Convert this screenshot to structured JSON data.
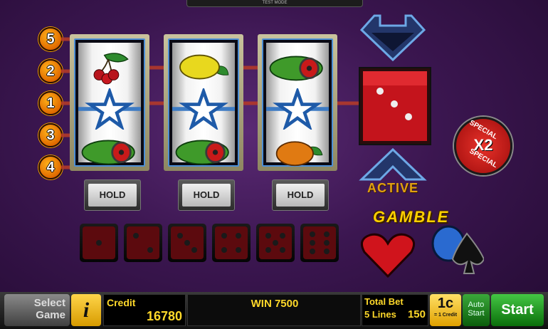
{
  "top_bar": {
    "mode_label": "TEST MODE"
  },
  "paylines": [
    "5",
    "2",
    "1",
    "3",
    "4"
  ],
  "reels": [
    {
      "top": "cherries",
      "middle": "star",
      "bottom": "watermelon"
    },
    {
      "top": "lemon",
      "middle": "star",
      "bottom": "watermelon"
    },
    {
      "top": "watermelon",
      "middle": "star",
      "bottom": "orange"
    }
  ],
  "hold_buttons": [
    "HOLD",
    "HOLD",
    "HOLD"
  ],
  "dice_values": [
    1,
    2,
    3,
    4,
    5,
    6
  ],
  "gamble": {
    "active_label": "ACTIVE",
    "special_text_top": "SPECIAL",
    "special_multiplier": "X2",
    "special_text_bottom": "SPECIAL",
    "gamble_label": "GAMBLE",
    "die_shown": 3
  },
  "footer": {
    "select_game_line1": "Select",
    "select_game_line2": "Game",
    "info_label": "i",
    "credit_label": "Credit",
    "credit_value": "16780",
    "win_label": "WIN 7500",
    "total_bet_label": "Total Bet",
    "lines_label": "5 Lines",
    "bet_value": "150",
    "coin_label": "1c",
    "coin_sub": "= 1 Credit",
    "auto_line1": "Auto",
    "auto_line2": "Start",
    "start_label": "Start"
  },
  "colors": {
    "accent_gold": "#ffd92a",
    "reel_frame_blue": "#4d8fd6",
    "die_red": "#c4141c"
  }
}
